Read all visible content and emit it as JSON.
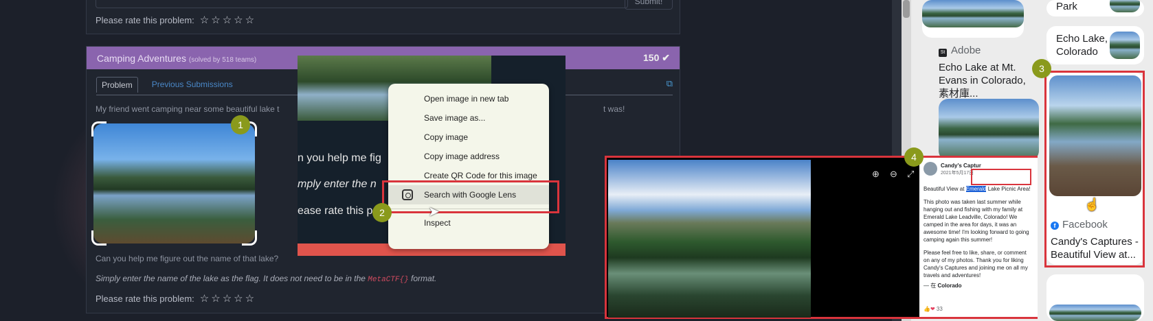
{
  "top_panel": {
    "submit_label": "Submit!",
    "rate_label": "Please rate this problem:",
    "stars": "☆☆☆☆☆"
  },
  "challenge": {
    "title": "Camping Adventures",
    "solved": "(solved by 518 teams)",
    "points": "150",
    "check_icon": "✔",
    "tab_problem": "Problem",
    "tab_previous": "Previous Submissions",
    "external_icon": "⧉",
    "description": "My friend went camping near some beautiful lake t",
    "description_end": "t was!",
    "question": "Can you help me figure out the name of that lake?",
    "instruction_pre": "Simply enter the name of the lake as the flag. It does not need to be in the ",
    "instruction_code": "MetaCTF{}",
    "instruction_post": " format.",
    "rate_label": "Please rate this problem:",
    "stars": "☆☆☆☆☆"
  },
  "overlay": {
    "line1": "n you help me fig",
    "line2": "mply enter the n",
    "line3": "ease rate this p"
  },
  "context_menu": {
    "items": [
      "Open image in new tab",
      "Save image as...",
      "Copy image",
      "Copy image address",
      "Create QR Code for this image"
    ],
    "lens": "Search with Google Lens",
    "inspect": "Inspect"
  },
  "badges": [
    "1",
    "2",
    "3",
    "4"
  ],
  "results": {
    "adobe_source": "Adobe",
    "adobe_title": "Echo Lake at Mt. Evans in Colorado, 素材庫...",
    "park": "Park",
    "echo": "Echo Lake, Colorado",
    "fb_source": "Facebook",
    "fb_title": "Candy's Captures - Beautiful View at..."
  },
  "post": {
    "author": "Candy's Captur",
    "date": "2021年5月17日",
    "headline_pre": "Beautiful View at ",
    "headline_hl": "Emerald",
    "headline_post": " Lake Picnic Area!",
    "body1": "This photo was taken last summer while hanging out and fishing with my family at Emerald Lake Leadville, Colorado! We camped in the area for days, it was an awesome time! I'm looking forward to going camping again this summer!",
    "body2": "Please feel free to like, share, or comment on any of my photos. Thank you for liking Candy's Captures and joining me on all my travels and adventures!",
    "location_pre": "— 在 ",
    "location": "Colorado",
    "likes": "33",
    "icons": [
      "zoom-in-icon",
      "zoom-out-icon",
      "fullscreen-icon"
    ]
  },
  "colors": {
    "accent_red": "#d9343c",
    "badge": "#8a9a1c",
    "header_purple": "#8a64ae"
  }
}
